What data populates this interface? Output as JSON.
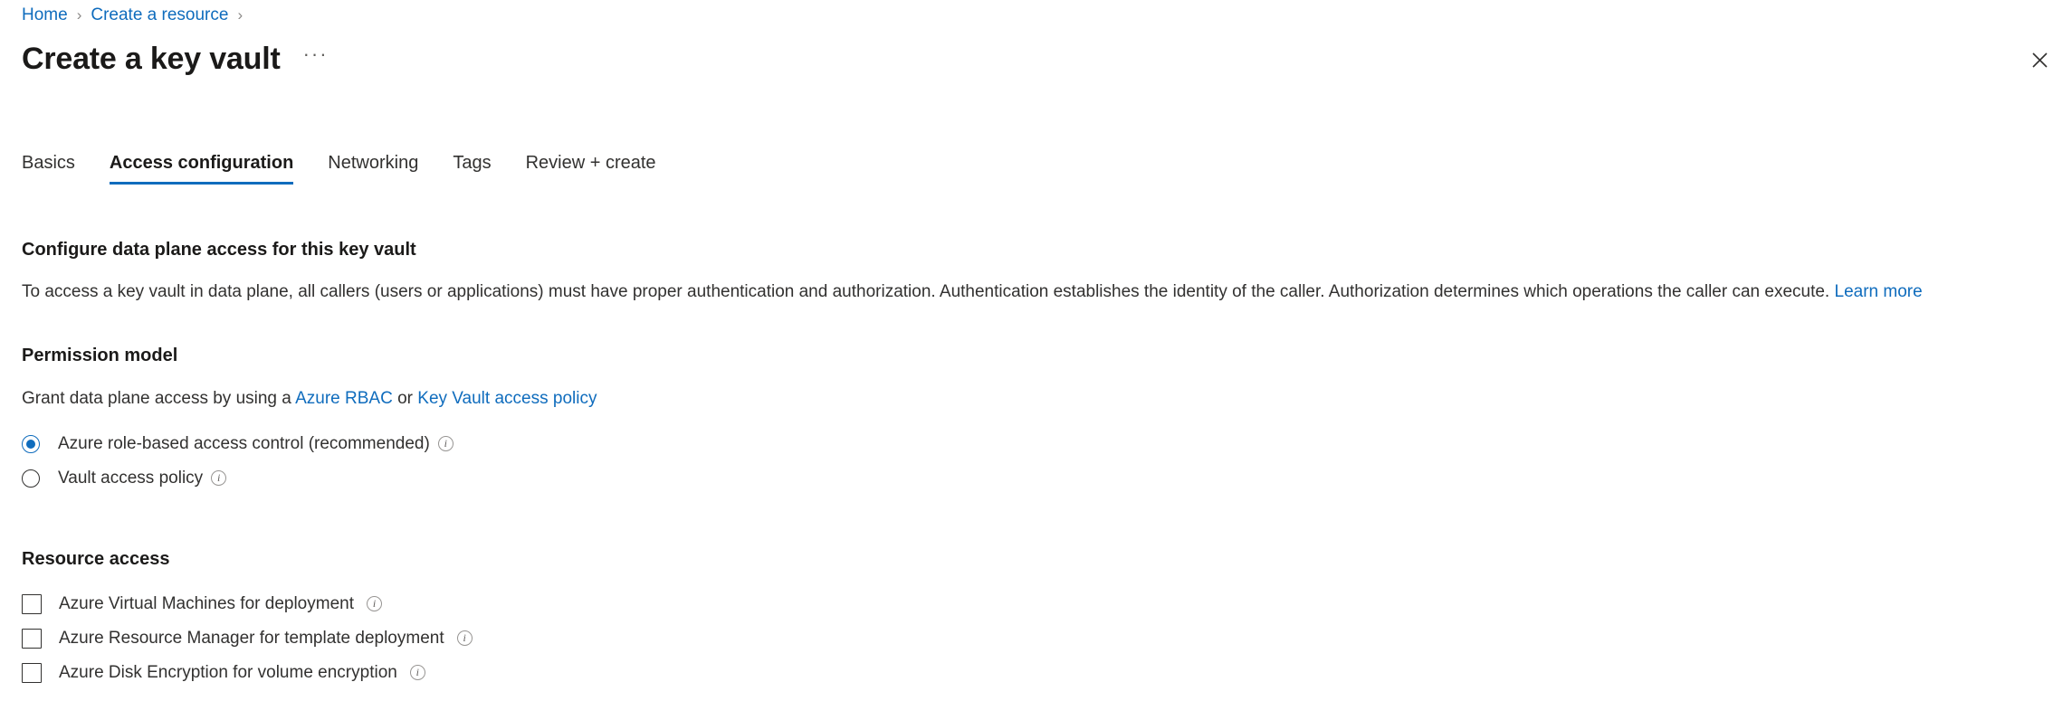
{
  "breadcrumb": {
    "items": [
      {
        "label": "Home"
      },
      {
        "label": "Create a resource"
      }
    ],
    "separator": "›"
  },
  "header": {
    "title": "Create a key vault",
    "more_label": "···",
    "more_icon": "ellipsis-icon",
    "close_icon": "close-icon"
  },
  "tabs": [
    {
      "label": "Basics",
      "active": false
    },
    {
      "label": "Access configuration",
      "active": true
    },
    {
      "label": "Networking",
      "active": false
    },
    {
      "label": "Tags",
      "active": false
    },
    {
      "label": "Review + create",
      "active": false
    }
  ],
  "main": {
    "section_title": "Configure data plane access for this key vault",
    "description": {
      "text": "To access a key vault in data plane, all callers (users or applications) must have proper authentication and authorization. Authentication establishes the identity of the caller. Authorization determines which operations the caller can execute.",
      "link": "Learn more"
    },
    "permission_model": {
      "heading": "Permission model",
      "sub_prefix": "Grant data plane access by using a",
      "link_rbac": "Azure RBAC",
      "sub_middle": "or",
      "link_policy": "Key Vault access policy",
      "options": [
        {
          "label": "Azure role-based access control (recommended)",
          "selected": true,
          "info_icon": "info-icon"
        },
        {
          "label": "Vault access policy",
          "selected": false,
          "info_icon": "info-icon"
        }
      ]
    },
    "resource_access": {
      "heading": "Resource access",
      "options": [
        {
          "label": "Azure Virtual Machines for deployment",
          "checked": false,
          "info_icon": "info-icon"
        },
        {
          "label": "Azure Resource Manager for template deployment",
          "checked": false,
          "info_icon": "info-icon"
        },
        {
          "label": "Azure Disk Encryption for volume encryption",
          "checked": false,
          "info_icon": "info-icon"
        }
      ]
    }
  },
  "colors": {
    "accent": "#0f6cbd",
    "text": "#323130",
    "heading": "#1b1a19",
    "separator": "#8a8886"
  }
}
